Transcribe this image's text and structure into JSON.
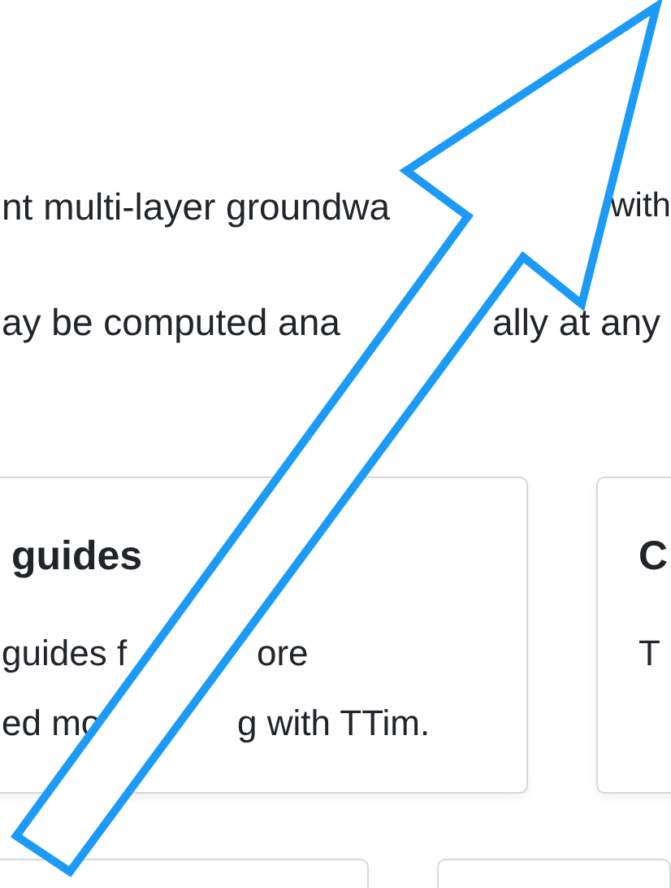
{
  "intro": [
    {
      "segments": [
        "nt multi-layer groundwa",
        "with"
      ]
    },
    {
      "segments": [
        "ay be computed ana",
        "ally at any"
      ]
    }
  ],
  "cards": [
    {
      "title": "guides",
      "lines": [
        [
          "guides f",
          "ore"
        ],
        [
          "ed mo",
          "g with TTim."
        ]
      ]
    },
    {
      "title": "C",
      "lines": [
        [
          "T"
        ]
      ]
    }
  ],
  "lower_cards": [
    {
      "kind": "card"
    },
    {
      "kind": "card"
    }
  ],
  "annotation": {
    "kind": "arrow"
  }
}
